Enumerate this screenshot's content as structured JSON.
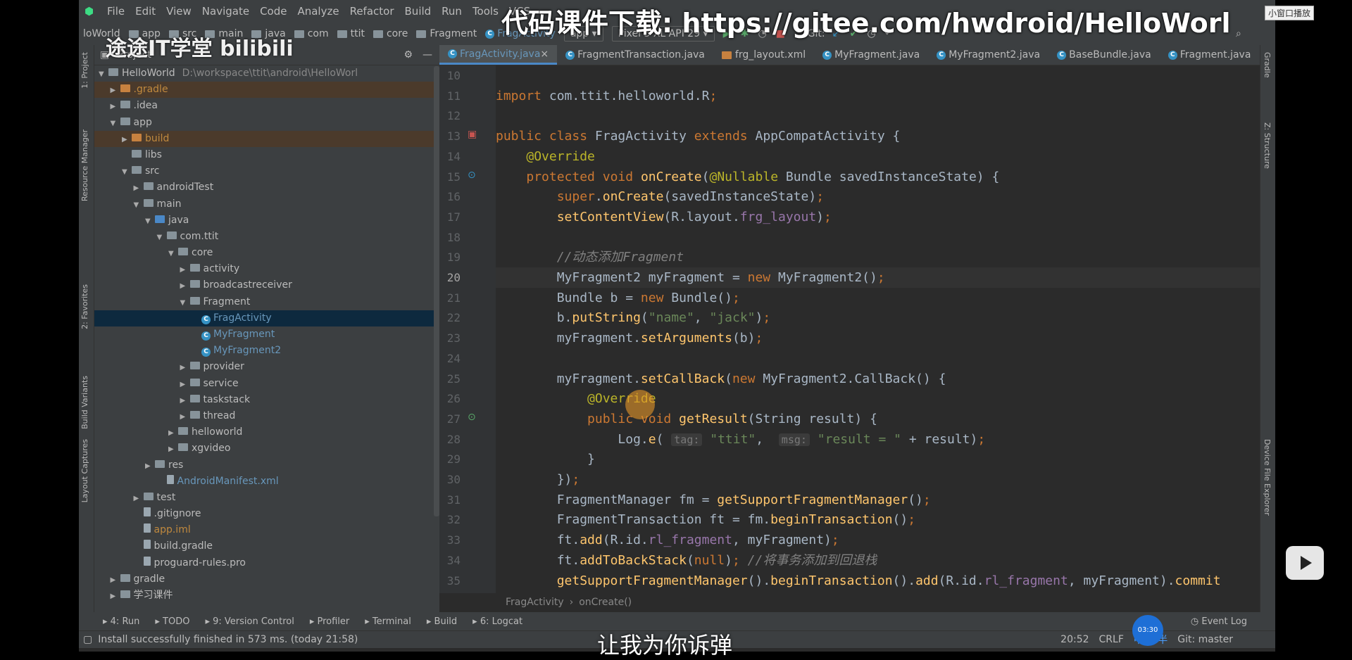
{
  "menu": [
    "File",
    "Edit",
    "View",
    "Navigate",
    "Code",
    "Analyze",
    "Refactor",
    "Build",
    "Run",
    "Tools",
    "VCS"
  ],
  "overlay": {
    "title": "代码课件下载: https://gitee.com/hwdroid/HelloWorl",
    "brand": "途途IT学堂 bilibili",
    "subtitle": "让我为你诉弹",
    "pip": "小窗口播放",
    "timer": "03:30"
  },
  "breadcrumb": [
    "loWorld",
    "app",
    "src",
    "main",
    "java",
    "com",
    "ttit",
    "core",
    "Fragment",
    "FragActivity"
  ],
  "toolbar": {
    "run_config": "app",
    "device": "Pixel 3 XL API 29",
    "git_label": "Git:"
  },
  "project_panel": {
    "title": "Project"
  },
  "tree": [
    {
      "label": "HelloWorld",
      "extra": "D:\\workspace\\ttit\\android\\HelloWorl",
      "depth": 0,
      "arrow": "▼",
      "icon": "folder",
      "color": "#bbbbbb"
    },
    {
      "label": ".gradle",
      "depth": 1,
      "arrow": "▶",
      "icon": "folder-orange",
      "color": "#c0893e",
      "hl": true
    },
    {
      "label": ".idea",
      "depth": 1,
      "arrow": "▶",
      "icon": "folder",
      "color": "#bbbbbb"
    },
    {
      "label": "app",
      "depth": 1,
      "arrow": "▼",
      "icon": "folder",
      "color": "#bbbbbb"
    },
    {
      "label": "build",
      "depth": 2,
      "arrow": "▶",
      "icon": "folder-orange",
      "color": "#c0893e",
      "hl": true
    },
    {
      "label": "libs",
      "depth": 2,
      "arrow": "",
      "icon": "folder",
      "color": "#bbbbbb"
    },
    {
      "label": "src",
      "depth": 2,
      "arrow": "▼",
      "icon": "folder",
      "color": "#bbbbbb"
    },
    {
      "label": "androidTest",
      "depth": 3,
      "arrow": "▶",
      "icon": "folder",
      "color": "#bbbbbb"
    },
    {
      "label": "main",
      "depth": 3,
      "arrow": "▼",
      "icon": "folder",
      "color": "#bbbbbb"
    },
    {
      "label": "java",
      "depth": 4,
      "arrow": "▼",
      "icon": "folder-blue",
      "color": "#bbbbbb"
    },
    {
      "label": "com.ttit",
      "depth": 5,
      "arrow": "▼",
      "icon": "folder",
      "color": "#bbbbbb"
    },
    {
      "label": "core",
      "depth": 6,
      "arrow": "▼",
      "icon": "folder",
      "color": "#bbbbbb"
    },
    {
      "label": "activity",
      "depth": 7,
      "arrow": "▶",
      "icon": "folder",
      "color": "#bbbbbb"
    },
    {
      "label": "broadcastreceiver",
      "depth": 7,
      "arrow": "▶",
      "icon": "folder",
      "color": "#bbbbbb"
    },
    {
      "label": "Fragment",
      "depth": 7,
      "arrow": "▼",
      "icon": "folder",
      "color": "#bbbbbb"
    },
    {
      "label": "FragActivity",
      "depth": 8,
      "arrow": "",
      "icon": "class",
      "color": "#6897bb",
      "sel": true
    },
    {
      "label": "MyFragment",
      "depth": 8,
      "arrow": "",
      "icon": "class",
      "color": "#6897bb"
    },
    {
      "label": "MyFragment2",
      "depth": 8,
      "arrow": "",
      "icon": "class",
      "color": "#6897bb"
    },
    {
      "label": "provider",
      "depth": 7,
      "arrow": "▶",
      "icon": "folder",
      "color": "#bbbbbb"
    },
    {
      "label": "service",
      "depth": 7,
      "arrow": "▶",
      "icon": "folder",
      "color": "#bbbbbb"
    },
    {
      "label": "taskstack",
      "depth": 7,
      "arrow": "▶",
      "icon": "folder",
      "color": "#bbbbbb"
    },
    {
      "label": "thread",
      "depth": 7,
      "arrow": "▶",
      "icon": "folder",
      "color": "#bbbbbb"
    },
    {
      "label": "helloworld",
      "depth": 6,
      "arrow": "▶",
      "icon": "folder",
      "color": "#bbbbbb"
    },
    {
      "label": "xgvideo",
      "depth": 6,
      "arrow": "▶",
      "icon": "folder",
      "color": "#bbbbbb"
    },
    {
      "label": "res",
      "depth": 4,
      "arrow": "▶",
      "icon": "folder",
      "color": "#bbbbbb"
    },
    {
      "label": "AndroidManifest.xml",
      "depth": 5,
      "arrow": "",
      "icon": "file",
      "color": "#6897bb"
    },
    {
      "label": "test",
      "depth": 3,
      "arrow": "▶",
      "icon": "folder",
      "color": "#bbbbbb"
    },
    {
      "label": ".gitignore",
      "depth": 3,
      "arrow": "",
      "icon": "file",
      "color": "#bbbbbb"
    },
    {
      "label": "app.iml",
      "depth": 3,
      "arrow": "",
      "icon": "file",
      "color": "#c0893e"
    },
    {
      "label": "build.gradle",
      "depth": 3,
      "arrow": "",
      "icon": "file",
      "color": "#bbbbbb"
    },
    {
      "label": "proguard-rules.pro",
      "depth": 3,
      "arrow": "",
      "icon": "file",
      "color": "#bbbbbb"
    },
    {
      "label": "gradle",
      "depth": 1,
      "arrow": "▶",
      "icon": "folder",
      "color": "#bbbbbb"
    },
    {
      "label": "学习课件",
      "depth": 1,
      "arrow": "▶",
      "icon": "folder",
      "color": "#bbbbbb"
    }
  ],
  "tabs": [
    "FragActivity.java",
    "FragmentTransaction.java",
    "frg_layout.xml",
    "MyFragment.java",
    "MyFragment2.java",
    "BaseBundle.java",
    "Fragment.java"
  ],
  "code": [
    {
      "n": "10",
      "t": ""
    },
    {
      "n": "11",
      "t": "import com.ttit.helloworld.R;"
    },
    {
      "n": "12",
      "t": ""
    },
    {
      "n": "13",
      "t": "public class FragActivity extends AppCompatActivity {"
    },
    {
      "n": "14",
      "t": "    @Override"
    },
    {
      "n": "15",
      "t": "    protected void onCreate(@Nullable Bundle savedInstanceState) {"
    },
    {
      "n": "16",
      "t": "        super.onCreate(savedInstanceState);"
    },
    {
      "n": "17",
      "t": "        setContentView(R.layout.frg_layout);"
    },
    {
      "n": "18",
      "t": ""
    },
    {
      "n": "19",
      "t": "        //动态添加Fragment"
    },
    {
      "n": "20",
      "t": "        MyFragment2 myFragment = new MyFragment2();"
    },
    {
      "n": "21",
      "t": "        Bundle b = new Bundle();"
    },
    {
      "n": "22",
      "t": "        b.putString(\"name\", \"jack\");"
    },
    {
      "n": "23",
      "t": "        myFragment.setArguments(b);"
    },
    {
      "n": "24",
      "t": ""
    },
    {
      "n": "25",
      "t": "        myFragment.setCallBack(new MyFragment2.CallBack() {"
    },
    {
      "n": "26",
      "t": "            @Override"
    },
    {
      "n": "27",
      "t": "            public void getResult(String result) {"
    },
    {
      "n": "28",
      "t": "                Log.e( tag: \"ttit\",  msg: \"result = \" + result);"
    },
    {
      "n": "29",
      "t": "            }"
    },
    {
      "n": "30",
      "t": "        });"
    },
    {
      "n": "31",
      "t": "        FragmentManager fm = getSupportFragmentManager();"
    },
    {
      "n": "32",
      "t": "        FragmentTransaction ft = fm.beginTransaction();"
    },
    {
      "n": "33",
      "t": "        ft.add(R.id.rl_fragment, myFragment);"
    },
    {
      "n": "34",
      "t": "        ft.addToBackStack(null); //将事务添加到回退栈"
    },
    {
      "n": "35",
      "t": "        getSupportFragmentManager().beginTransaction().add(R.id.rl_fragment, myFragment).commit"
    }
  ],
  "editor_breadcrumb": [
    "FragActivity",
    "onCreate()"
  ],
  "tool_tabs": [
    "4: Run",
    "TODO",
    "9: Version Control",
    "Profiler",
    "Terminal",
    "Build",
    "6: Logcat"
  ],
  "event_log": "Event Log",
  "status": {
    "message": "Install successfully finished in 573 ms. (today 21:58)",
    "position": "20:52",
    "line_sep": "CRLF",
    "ime": "中 °, 半",
    "git": "Git: master"
  },
  "left_stripe": [
    "1: Project",
    "Resource Manager",
    "2: Favorites",
    "Build Variants",
    "Layout Captures"
  ],
  "right_stripe": [
    "Gradle",
    "Z: Structure",
    "Device File Explorer"
  ],
  "colors": {
    "keyword": "#cc7832",
    "annotation": "#bbb529",
    "method": "#ffc66d",
    "string": "#6a8759",
    "comment": "#808080"
  }
}
